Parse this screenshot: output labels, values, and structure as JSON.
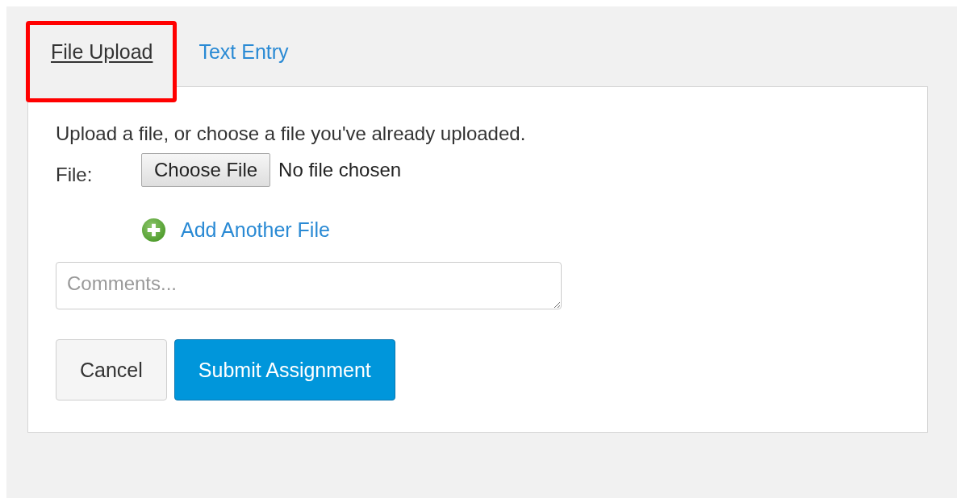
{
  "tabs": [
    {
      "label": "File Upload",
      "selected": true,
      "highlighted": true
    },
    {
      "label": "Text Entry",
      "selected": false,
      "highlighted": false
    }
  ],
  "instructions": "Upload a file, or choose a file you've already uploaded.",
  "file_field": {
    "label": "File:",
    "button": "Choose File",
    "status": "No file chosen"
  },
  "add_file_link": "Add Another File",
  "comments": {
    "placeholder": "Comments..."
  },
  "buttons": [
    {
      "label": "Cancel",
      "kind": "secondary"
    },
    {
      "label": "Submit Assignment",
      "kind": "primary"
    }
  ]
}
